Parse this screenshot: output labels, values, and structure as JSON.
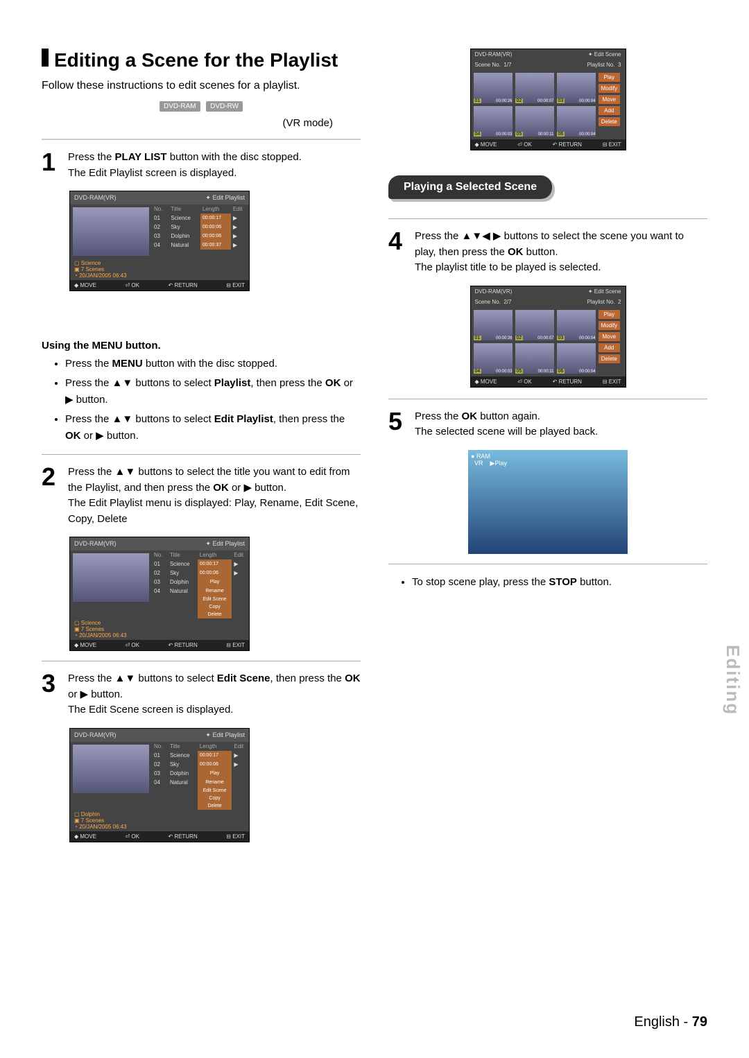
{
  "title": "Editing a Scene for the Playlist",
  "intro": "Follow these instructions to edit scenes for a playlist.",
  "discs": [
    "DVD-RAM",
    "DVD-RW"
  ],
  "vr_mode": "(VR mode)",
  "step1": {
    "num": "1",
    "text_a": "Press the ",
    "bold_a": "PLAY LIST",
    "text_b": " button with the disc stopped.",
    "text_c": "The Edit Playlist screen is displayed."
  },
  "osd_common": {
    "device": "DVD-RAM(VR)",
    "move": "MOVE",
    "ok": "OK",
    "return": "RETURN",
    "exit": "EXIT"
  },
  "osd1": {
    "screen": "Edit Playlist",
    "cols": [
      "No.",
      "Title",
      "Length",
      "Edit"
    ],
    "rows": [
      {
        "no": "01",
        "title": "Science",
        "len": "00:00:17"
      },
      {
        "no": "02",
        "title": "Sky",
        "len": "00:00:06"
      },
      {
        "no": "03",
        "title": "Dolphin",
        "len": "00:00:06"
      },
      {
        "no": "04",
        "title": "Natural",
        "len": "00:00:37"
      }
    ],
    "info_title": "Science",
    "info_scenes": "7 Scenes",
    "info_date": "20/JAN/2005 06:43"
  },
  "menu_sub": {
    "head": "Using the MENU button.",
    "b1_a": "Press the ",
    "b1_bold": "MENU",
    "b1_b": " button with the disc stopped.",
    "b2_a": "Press the ▲▼ buttons to select ",
    "b2_bold": "Playlist",
    "b2_b": ", then press the ",
    "b2_bold2": "OK",
    "b2_c": " or ▶ button.",
    "b3_a": "Press the ▲▼ buttons to select ",
    "b3_bold": "Edit Playlist",
    "b3_b": ", then press the ",
    "b3_bold2": "OK",
    "b3_c": " or ▶ button."
  },
  "step2": {
    "num": "2",
    "a": "Press the ▲▼ buttons to select the title you want to edit from the Playlist, and then press the ",
    "bold": "OK",
    "b": " or ▶ button.",
    "c": "The Edit Playlist menu is displayed: Play, Rename, Edit Scene, Copy, Delete"
  },
  "osd2": {
    "screen": "Edit Playlist",
    "rows": [
      {
        "no": "01",
        "title": "Science",
        "len": "00:00:17"
      },
      {
        "no": "02",
        "title": "Sky",
        "len": "00:00:06"
      },
      {
        "no": "03",
        "title": "Dolphin",
        "menu": "Play"
      },
      {
        "no": "04",
        "title": "Natural",
        "menu": "Rename"
      }
    ],
    "extra_menu": [
      "Edit Scene",
      "Copy",
      "Delete"
    ],
    "info_title": "Science",
    "info_scenes": "7 Scenes",
    "info_date": "20/JAN/2005 06:43"
  },
  "step3": {
    "num": "3",
    "a": "Press the  ▲▼ buttons to select ",
    "bold": "Edit Scene",
    "b": ", then press the ",
    "bold2": "OK",
    "c": " or ▶ button.",
    "d": "The Edit Scene screen is displayed."
  },
  "osd3": {
    "screen": "Edit Playlist",
    "rows": [
      {
        "no": "01",
        "title": "Science",
        "len": "00:00:17"
      },
      {
        "no": "02",
        "title": "Sky",
        "len": "00:00:06"
      },
      {
        "no": "03",
        "title": "Dolphin",
        "menu": "Play"
      },
      {
        "no": "04",
        "title": "Natural",
        "menu": "Rename"
      }
    ],
    "extra_menu": [
      "Edit Scene",
      "Copy",
      "Delete"
    ],
    "info_title": "Dolphin",
    "info_scenes": "7 Scenes",
    "info_date": "20/JAN/2005 06:43"
  },
  "osd_scene_a": {
    "screen": "Edit Scene",
    "scene_no_label": "Scene No.",
    "scene_no": "1/7",
    "playlist_label": "Playlist No.",
    "playlist_no": "3",
    "cells": [
      {
        "n": "01",
        "t": "00:00:26"
      },
      {
        "n": "02",
        "t": "00:00:07"
      },
      {
        "n": "03",
        "t": "00:00:04"
      },
      {
        "n": "04",
        "t": "00:00:03"
      },
      {
        "n": "05",
        "t": "00:00:11"
      },
      {
        "n": "06",
        "t": "00:00:04"
      }
    ],
    "btns": [
      "Play",
      "Modify",
      "Move",
      "Add",
      "Delete"
    ]
  },
  "pill": "Playing a Selected Scene",
  "step4": {
    "num": "4",
    "a": "Press the ▲▼◀ ▶ buttons to select the scene you want to play, then press the ",
    "bold": "OK",
    "b": " button.",
    "c": "The playlist title to be played is selected."
  },
  "osd_scene_b": {
    "screen": "Edit Scene",
    "scene_no_label": "Scene No.",
    "scene_no": "2/7",
    "playlist_label": "Playlist No.",
    "playlist_no": "2",
    "cells": [
      {
        "n": "01",
        "t": "00:00:26"
      },
      {
        "n": "02",
        "t": "00:00:07"
      },
      {
        "n": "03",
        "t": "00:00:04"
      },
      {
        "n": "04",
        "t": "00:00:03"
      },
      {
        "n": "05",
        "t": "00:00:11"
      },
      {
        "n": "06",
        "t": "00:00:04"
      }
    ],
    "btns": [
      "Play",
      "Modify",
      "Move",
      "Add",
      "Delete"
    ]
  },
  "step5": {
    "num": "5",
    "a": "Press the ",
    "bold": "OK",
    "b": " button again.",
    "c": "The selected scene will be played back."
  },
  "play_panel": {
    "tag1": "RAM",
    "tag2": "VR",
    "tag3": "▶Play"
  },
  "stop_note": {
    "a": "To stop scene play, press the ",
    "bold": "STOP",
    "b": " button."
  },
  "side": "Editing",
  "footer_lang": "English - ",
  "footer_page": "79"
}
